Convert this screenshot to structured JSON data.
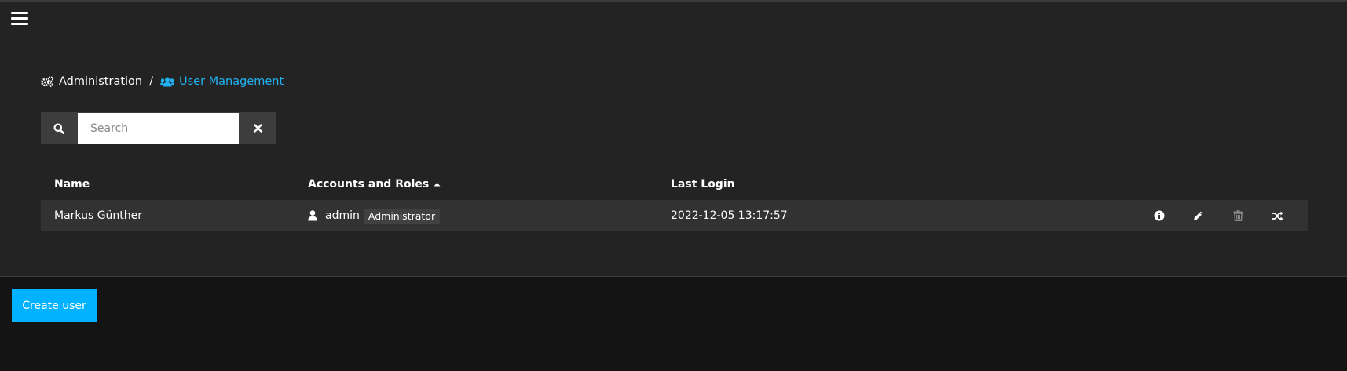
{
  "breadcrumb": {
    "administration": "Administration",
    "separator": "/",
    "user_management": "User Management"
  },
  "search": {
    "placeholder": "Search",
    "value": ""
  },
  "table": {
    "columns": {
      "name": "Name",
      "accounts": "Accounts and Roles",
      "last_login": "Last Login"
    },
    "rows": [
      {
        "name": "Markus Günther",
        "account": "admin",
        "role": "Administrator",
        "last_login": "2022-12-05 13:17:57"
      }
    ]
  },
  "icons": {
    "menu": "hamburger-icon",
    "administration": "cogs-icon",
    "user_management": "users-icon",
    "search": "search-icon",
    "clear": "close-icon",
    "sort": "sort-asc-icon",
    "account": "user-icon",
    "info": "info-icon",
    "edit": "pencil-icon",
    "delete": "trash-icon",
    "switch": "shuffle-icon"
  },
  "footer": {
    "create_label": "Create user"
  },
  "colors": {
    "accent": "#00b2ff",
    "breadcrumb_active": "#20b3f4",
    "panel": "#232323",
    "row": "#323232",
    "footer": "#141414"
  }
}
